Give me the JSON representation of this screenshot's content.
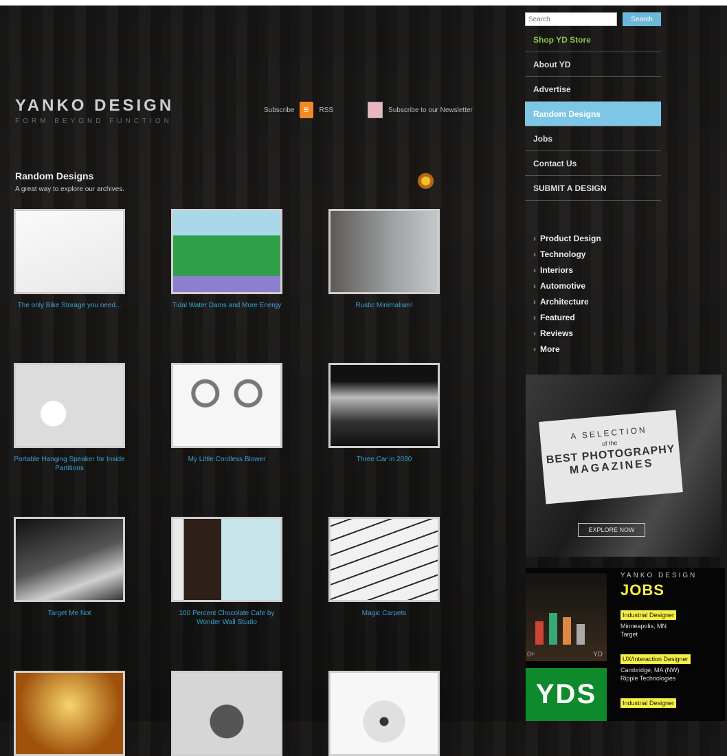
{
  "header": {
    "logo_main": "YANKO DESIGN",
    "logo_tagline": "FORM BEYOND FUNCTION",
    "subscribe_label": "Subscribe",
    "rss_label": "RSS",
    "newsletter_label": "Subscribe to our Newsletter"
  },
  "search": {
    "placeholder": "Search",
    "button_label": "Search"
  },
  "nav": {
    "items": [
      {
        "label": "Shop YD Store"
      },
      {
        "label": "About YD"
      },
      {
        "label": "Advertise"
      },
      {
        "label": "Random Designs"
      },
      {
        "label": "Jobs"
      },
      {
        "label": "Contact Us"
      },
      {
        "label": "SUBMIT A DESIGN"
      }
    ]
  },
  "categories": [
    "Product Design",
    "Technology",
    "Interiors",
    "Automotive",
    "Architecture",
    "Featured",
    "Reviews",
    "More"
  ],
  "main": {
    "title": "Random Designs",
    "subtitle": "A great way to explore our archives."
  },
  "designs": [
    {
      "caption": "The only Bike Storage you need...",
      "bg": "#f2f2f2"
    },
    {
      "caption": "Tidal Water Dams and More Energy",
      "bg": "#2f9f4a"
    },
    {
      "caption": "Rustic Minimalism!",
      "bg": "#8b8f92"
    },
    {
      "caption": "Portable Hanging Speaker for Inside Partitions",
      "bg": "#dcdcdc"
    },
    {
      "caption": "My Little Cordless Blower",
      "bg": "#f4f4f4"
    },
    {
      "caption": "Three Car in 2030",
      "bg": "#222222"
    },
    {
      "caption": "Target Me Not",
      "bg": "#2a2a2a"
    },
    {
      "caption": "100 Percent Chocolate Cafe by Wonder Wall Studio",
      "bg": "#c9c9c9"
    },
    {
      "caption": "Magic Carpets",
      "bg": "#efefef"
    },
    {
      "caption": "",
      "bg": "#c5821e"
    },
    {
      "caption": "",
      "bg": "#d0d0d0"
    },
    {
      "caption": "",
      "bg": "#f1f1f1"
    }
  ],
  "ad": {
    "line1": "A SELECTION",
    "line2": "of the",
    "line3": "BEST PHOTOGRAPHY",
    "line4": "MAGAZINES",
    "cta": "EXPLORE NOW"
  },
  "jobs": {
    "brand": "YANKO DESIGN",
    "title": "JOBS",
    "nav_prev": "0+",
    "nav_next": "YD",
    "yds_logo": "YDS",
    "listings": [
      {
        "role": "Industrial Designer",
        "location": "Minneapolis, MN",
        "company": "Target"
      },
      {
        "role": "UX/Interaction Designer",
        "location": "Cambridge, MA (NW)",
        "company": "Ripple Technologies"
      },
      {
        "role": "Industrial Designer",
        "location": "",
        "company": ""
      }
    ]
  }
}
